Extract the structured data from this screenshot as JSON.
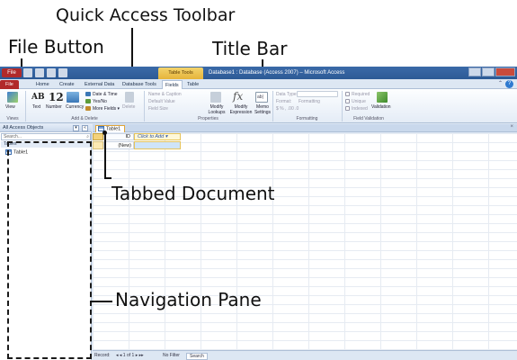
{
  "callouts": {
    "qat": "Quick Access Toolbar",
    "file": "File Button",
    "title": "Title Bar",
    "doc": "Tabbed Document",
    "nav": "Navigation Pane"
  },
  "window": {
    "file_btn": "File",
    "ctx_tab": "Table Tools",
    "title": "Database1 : Database (Access 2007) – Microsoft Access",
    "help": "?",
    "tabs": [
      "File",
      "Home",
      "Create",
      "External Data",
      "Database Tools",
      "Fields",
      "Table"
    ]
  },
  "ribbon": {
    "view": "View",
    "text": "Text",
    "number": "Number",
    "currency": "Currency",
    "text_glyph": "AB",
    "number_glyph": "12",
    "date_time": "Date & Time",
    "yes_no": "Yes/No",
    "more_fields": "More Fields ▾",
    "delete": "Delete",
    "name_caption": "Name & Caption",
    "default_value": "Default Value",
    "field_size": "Field Size",
    "modify_lookups": "Modify Lookups",
    "modify_expression": "Modify Expression",
    "memo_settings": "Memo Settings",
    "fx": "fx",
    "abl": "ab|",
    "data_type": "Data Type:",
    "format": "Format:",
    "format_val": "Formatting",
    "currency_sym": "$  %  ,  .00  .0",
    "required": "Required",
    "unique": "Unique",
    "indexed": "Indexed",
    "validation": "Validation",
    "groups": [
      "Views",
      "Add & Delete",
      "Properties",
      "Formatting",
      "Field Validation"
    ]
  },
  "nav": {
    "header": "All Access Objects",
    "search_placeholder": "Search...",
    "group": "Tables",
    "item": "Table1"
  },
  "doc": {
    "tab": "Table1",
    "close": "×",
    "col_id": "ID",
    "col_add": "Click to Add ▾",
    "new_row": "(New)"
  },
  "status": {
    "record": "Record:",
    "nav_text": "◂ ◂  1 of 1  ▸ ▸▸",
    "no_filter": "No Filter",
    "search": "Search"
  }
}
